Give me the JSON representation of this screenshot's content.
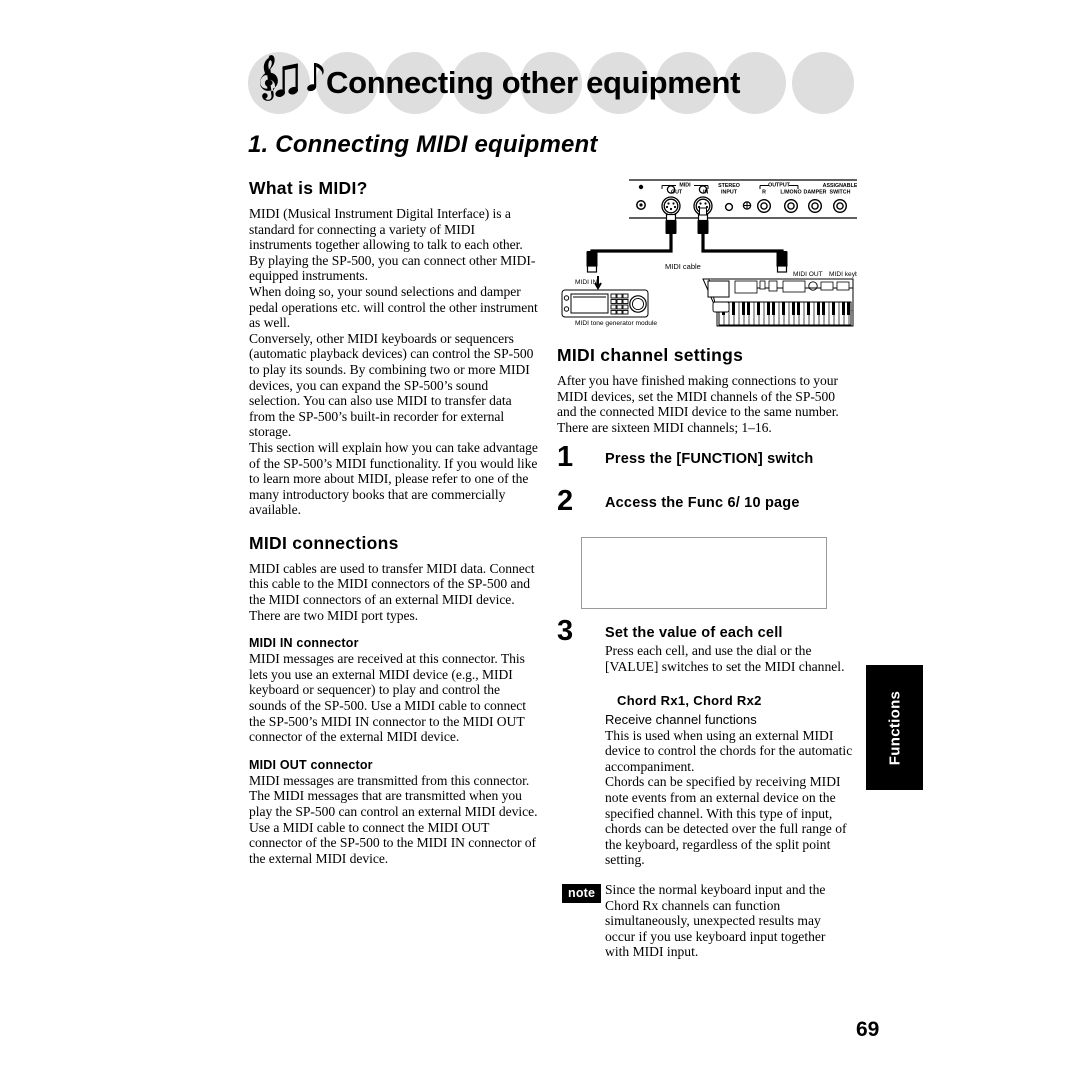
{
  "header": {
    "title": "Connecting other equipment",
    "icons": [
      "treble-clef-icon",
      "beamed-eighth-notes-icon",
      "eighth-note-icon"
    ],
    "circle_color": "#dedede",
    "circle_count": 9
  },
  "section_title": "1. Connecting MIDI equipment",
  "left_column": {
    "heading_1": "What is MIDI?",
    "paragraphs_1": [
      "MIDI (Musical Instrument Digital Interface) is a standard for connecting a variety of MIDI instruments together allowing to talk to each other. By playing the SP-500, you can connect other MIDI-equipped instruments.",
      "When doing so, your sound selections and damper pedal operations etc. will control the other instrument as well.",
      "Conversely, other MIDI keyboards or sequencers (automatic playback devices) can control the SP-500 to play its sounds. By combining two or more MIDI devices, you can expand the SP-500’s sound selection. You can also use MIDI to transfer data from the SP-500’s built-in recorder for external storage.",
      "This section will explain how you can take advantage of the SP-500’s MIDI functionality. If you would like to learn more about MIDI, please refer to one of the many introductory books that are commercially available."
    ],
    "heading_2": "MIDI connections",
    "paragraphs_2": [
      "MIDI cables are used to transfer MIDI data. Connect this cable to the MIDI connectors of the SP-500 and the MIDI connectors of an external MIDI device. There are two MIDI port types."
    ],
    "subheading_in": "MIDI IN connector",
    "paragraphs_in": [
      "MIDI messages are received at this connector. This lets you use an external MIDI device (e.g., MIDI keyboard or sequencer) to play and control the sounds of the SP-500. Use a MIDI cable to connect the SP-500’s MIDI IN connector to the MIDI OUT connector of the external MIDI device."
    ],
    "subheading_out": "MIDI OUT connector",
    "paragraphs_out": [
      "MIDI messages are transmitted from this connector.",
      "The MIDI messages that are transmitted when you play the SP-500 can control an external MIDI device. Use a MIDI cable to connect the MIDI OUT connector of the SP-500 to the MIDI IN connector of the external MIDI device."
    ]
  },
  "diagram": {
    "panel_labels": {
      "midi": "MIDI",
      "midi_out": "OUT",
      "midi_in": "IN",
      "stereo_input_line1": "STEREO",
      "stereo_input_line2": "INPUT",
      "output": "OUTPUT",
      "output_r": "R",
      "output_lmono": "L/MONO",
      "damper": "DAMPER",
      "assignable_line1": "ASSIGNABLE",
      "assignable_line2": "SWITCH"
    },
    "cable_label": "MIDI cable",
    "tone_module_in_label": "MIDI IN",
    "tone_module_caption": "MIDI tone generator module",
    "keyboard_out_label": "MIDI OUT",
    "keyboard_caption": "MIDI keyboard"
  },
  "right_column": {
    "heading": "MIDI channel settings",
    "intro": "After you have finished making connections to your MIDI devices, set the MIDI channels of the SP-500 and the connected MIDI device to the same number. There are sixteen MIDI channels; 1–16.",
    "steps": [
      {
        "num": "1",
        "title": "Press the [FUNCTION] switch",
        "text": ""
      },
      {
        "num": "2",
        "title": "Access the  Func 6/ 10   page",
        "text": ""
      },
      {
        "num": "3",
        "title": "Set the value of each cell",
        "text": "Press each cell, and use the dial or the [VALUE] switches to set the MIDI channel."
      }
    ],
    "chord_rx": {
      "heading": "Chord Rx1,    Chord Rx2",
      "subtitle": "Receive channel functions",
      "paragraphs": [
        "This is used when using an external MIDI device to control the chords for the automatic accompaniment.",
        "Chords can be specified by receiving MIDI note events from an external device on the specified channel. With this type of input, chords can be detected over the full range of the keyboard, regardless of the split point setting."
      ]
    },
    "note": {
      "badge": "note",
      "text": "Since the normal keyboard input and the Chord Rx channels can function simultaneously, unexpected results may occur if you use keyboard input together with MIDI input."
    }
  },
  "side_tab": {
    "label": "Functions",
    "background": "#000000",
    "text_color": "#ffffff"
  },
  "page_number": "69"
}
